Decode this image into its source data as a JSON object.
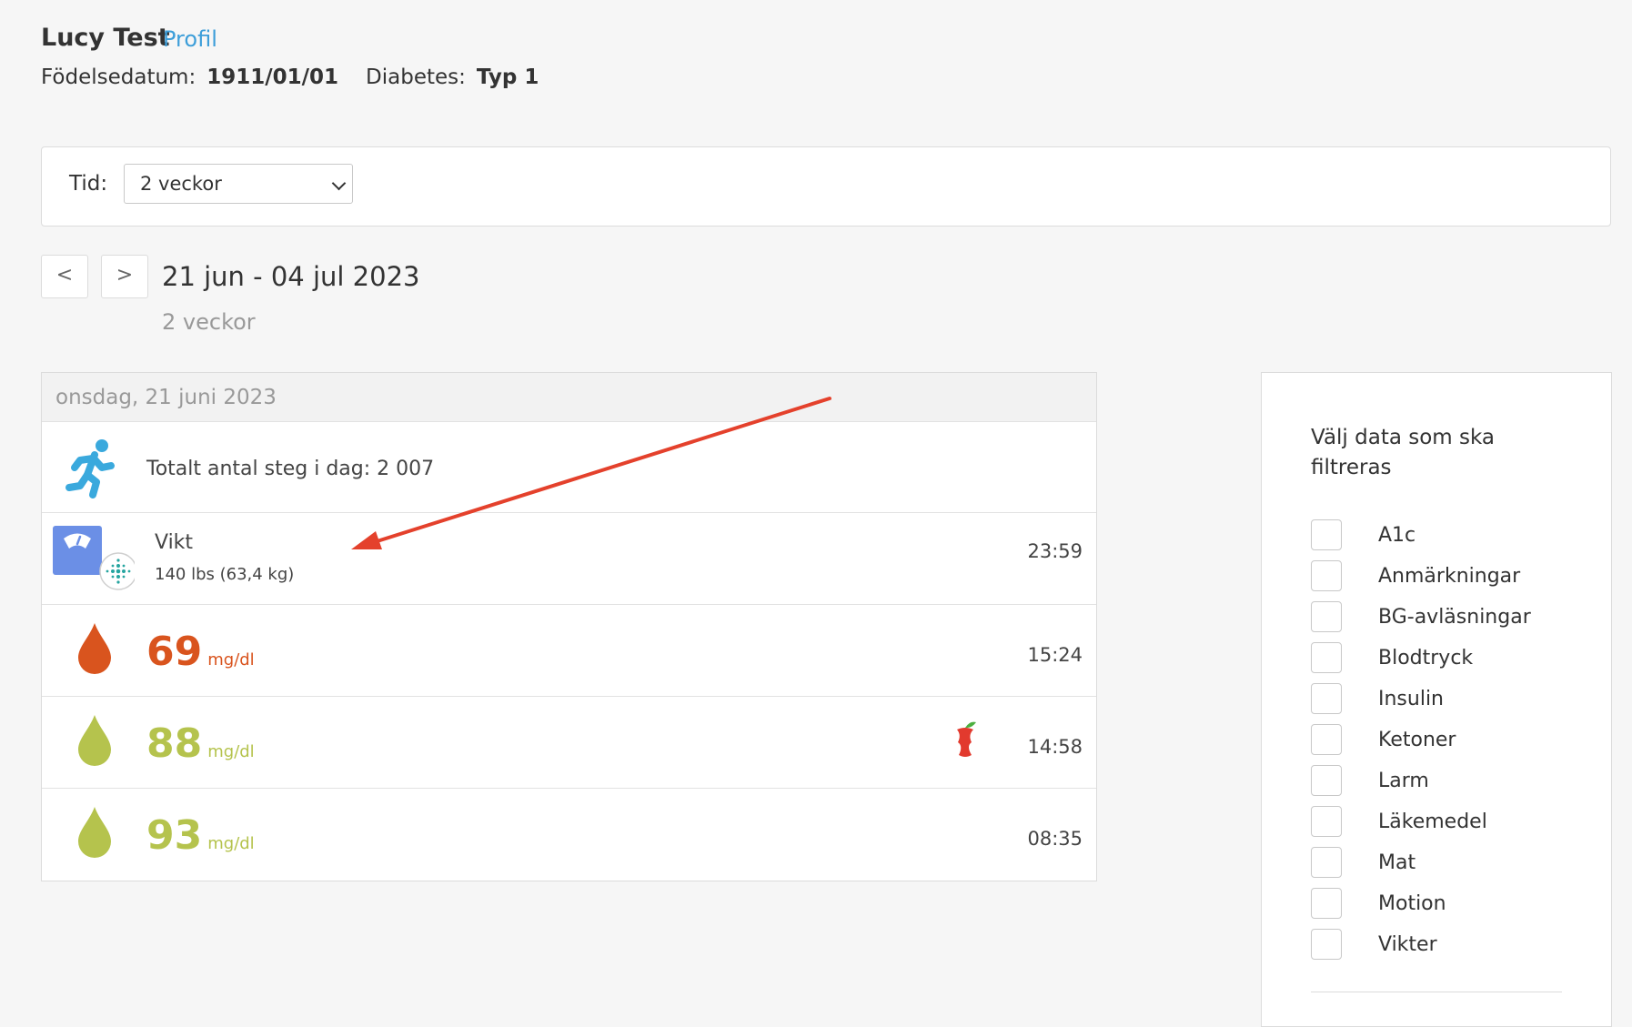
{
  "header": {
    "name": "Lucy Test",
    "profile_link": "Profil",
    "dob_label": "Födelsedatum:",
    "dob_value": "1911/01/01",
    "diabetes_label": "Diabetes:",
    "diabetes_value": "Typ 1"
  },
  "time_filter": {
    "label": "Tid:",
    "selected": "2 veckor"
  },
  "navigation": {
    "prev_label": "<",
    "next_label": ">",
    "range": "21 jun - 04 jul 2023",
    "range_sub": "2 veckor"
  },
  "day": {
    "header": "onsdag, 21 juni 2023",
    "steps_text": "Totalt antal steg i dag: 2 007",
    "weight": {
      "title": "Vikt",
      "value": "140 lbs (63,4 kg)",
      "time": "23:59"
    },
    "readings": [
      {
        "value": "69",
        "unit": "mg/dl",
        "time": "15:24",
        "color": "#d9541e",
        "has_food_icon": false
      },
      {
        "value": "88",
        "unit": "mg/dl",
        "time": "14:58",
        "color": "#b5c34d",
        "has_food_icon": true
      },
      {
        "value": "93",
        "unit": "mg/dl",
        "time": "08:35",
        "color": "#b5c34d",
        "has_food_icon": false
      }
    ]
  },
  "filter": {
    "title": "Välj data som ska filtreras",
    "options": [
      "A1c",
      "Anmärkningar",
      "BG-avläsningar",
      "Blodtryck",
      "Insulin",
      "Ketoner",
      "Larm",
      "Läkemedel",
      "Mat",
      "Motion",
      "Vikter"
    ]
  },
  "colors": {
    "link": "#3d9ed9",
    "steps_icon": "#3aa9dd",
    "scale_icon": "#6b8fe6",
    "low_reading": "#d9541e",
    "normal_reading": "#b5c34d",
    "annotation_arrow": "#e4412c"
  }
}
